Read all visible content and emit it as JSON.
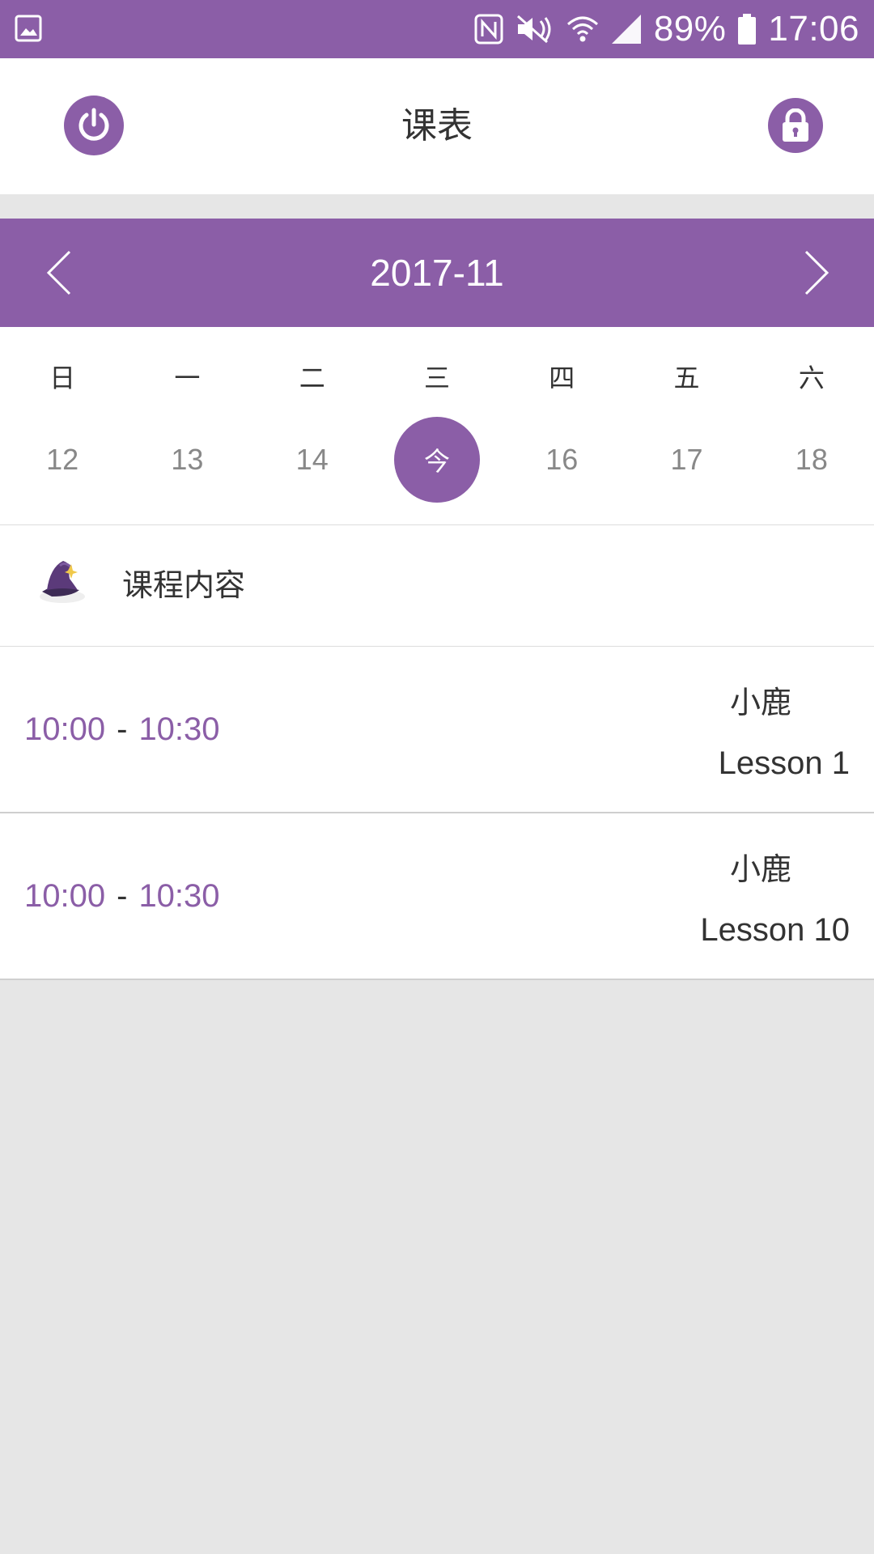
{
  "status_bar": {
    "battery": "89%",
    "time": "17:06"
  },
  "header": {
    "title": "课表"
  },
  "calendar": {
    "month": "2017-11",
    "weekdays": [
      "日",
      "一",
      "二",
      "三",
      "四",
      "五",
      "六"
    ],
    "dates": [
      "12",
      "13",
      "14",
      "今",
      "16",
      "17",
      "18"
    ],
    "today_index": 3
  },
  "section": {
    "title": "课程内容"
  },
  "lessons": [
    {
      "start": "10:00",
      "sep": "-",
      "end": "10:30",
      "teacher": "小鹿",
      "name": "Lesson 1"
    },
    {
      "start": "10:00",
      "sep": "-",
      "end": "10:30",
      "teacher": "小鹿",
      "name": "Lesson 10"
    }
  ],
  "colors": {
    "accent": "#8b5ea7"
  }
}
